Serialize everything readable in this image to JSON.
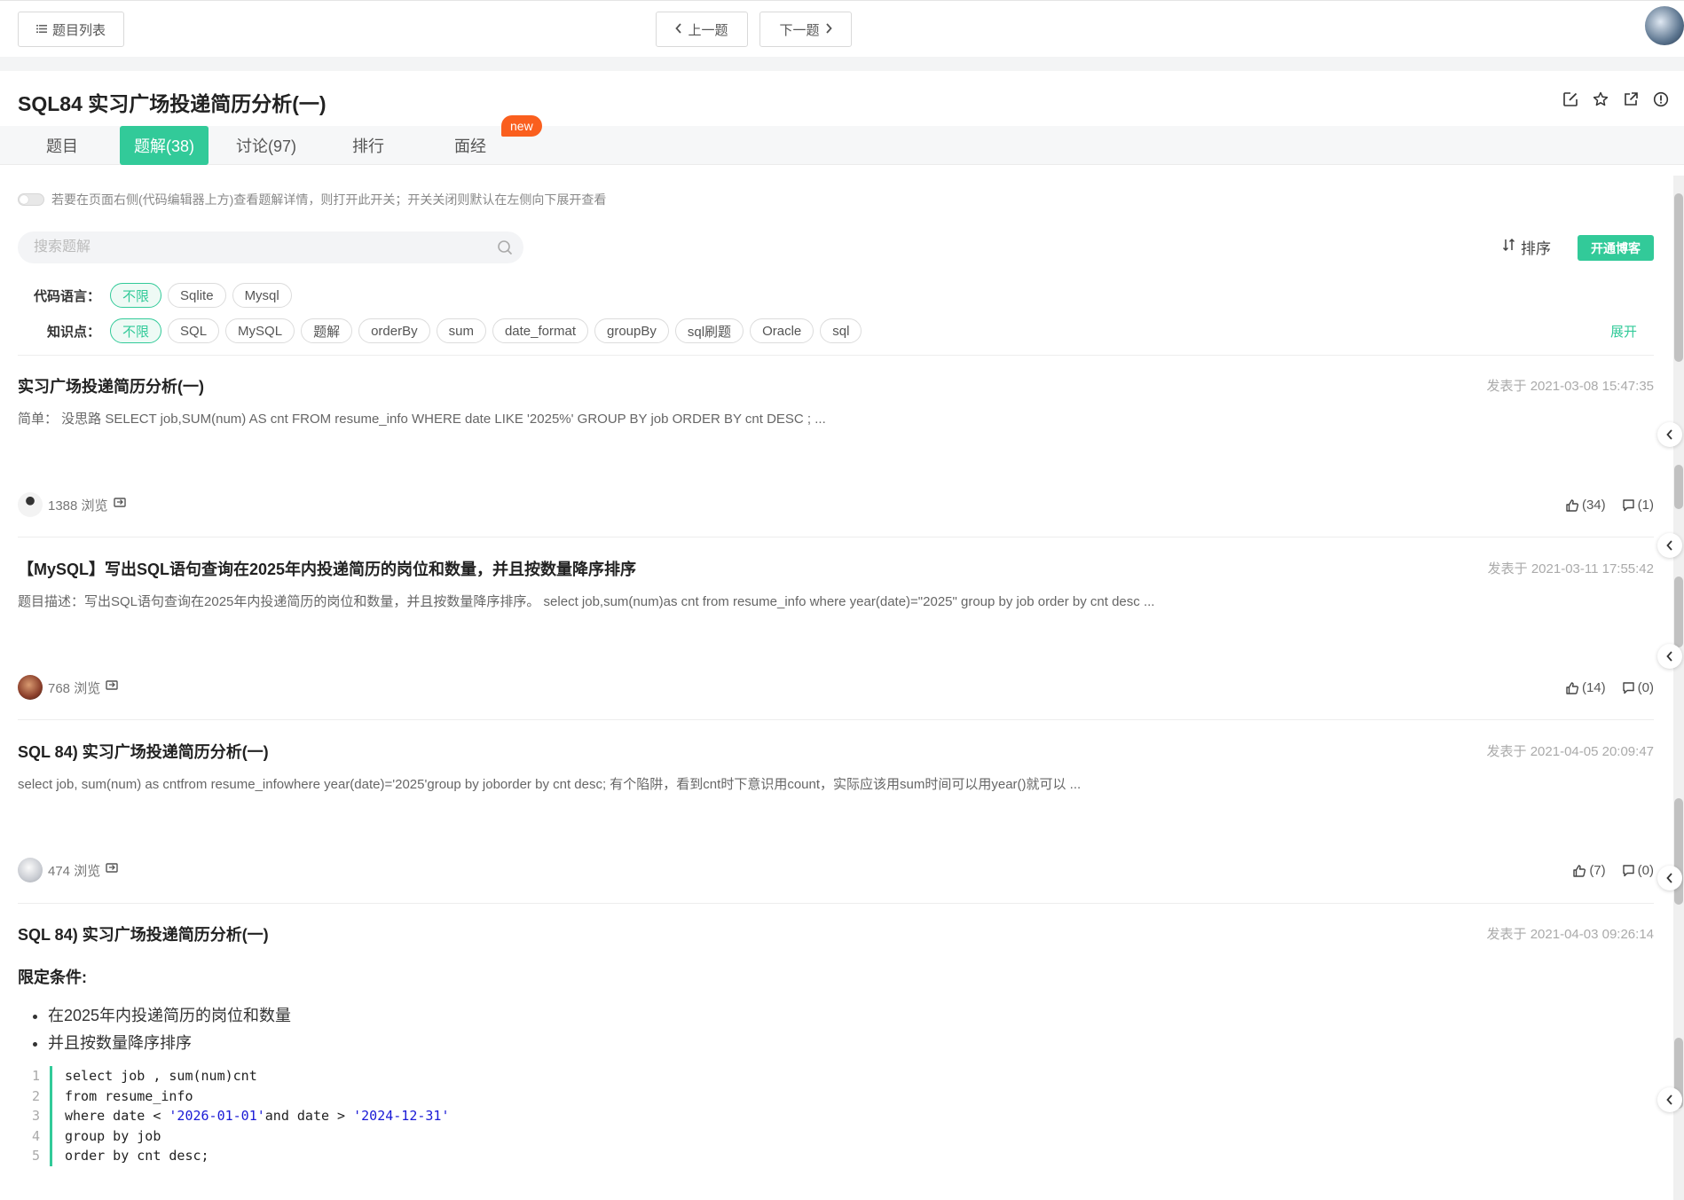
{
  "topbar": {
    "list_label": "题目列表",
    "prev_label": "上一题",
    "next_label": "下一题"
  },
  "problem": {
    "title": "SQL84  实习广场投递简历分析(一)"
  },
  "tabs": [
    {
      "label": "题目"
    },
    {
      "label": "题解(38)"
    },
    {
      "label": "讨论(97)"
    },
    {
      "label": "排行"
    },
    {
      "label": "面经"
    }
  ],
  "badge_new": "new",
  "toggle_hint": "若要在页面右侧(代码编辑器上方)查看题解详情，则打开此开关；开关关闭则默认在左侧向下展开查看",
  "search": {
    "placeholder": "搜索题解"
  },
  "sort_label": "排序",
  "blog_button": "开通博客",
  "filters": {
    "language_label": "代码语言：",
    "languages": [
      "不限",
      "Sqlite",
      "Mysql"
    ],
    "topic_label": "知识点：",
    "topics": [
      "不限",
      "SQL",
      "MySQL",
      "题解",
      "orderBy",
      "sum",
      "date_format",
      "groupBy",
      "sql刷题",
      "Oracle",
      "sql"
    ],
    "expand_label": "展开"
  },
  "articles": [
    {
      "title": "实习广场投递简历分析(一)",
      "date": "发表于 2021-03-08 15:47:35",
      "summary": "简单：  没思路 SELECT job,SUM(num) AS cnt FROM resume_info WHERE date LIKE '2025%' GROUP BY job ORDER BY cnt DESC ; ...",
      "views": "1388 浏览",
      "likes": "(34)",
      "comments": "(1)"
    },
    {
      "title": "【MySQL】写出SQL语句查询在2025年内投递简历的岗位和数量，并且按数量降序排序",
      "date": "发表于 2021-03-11 17:55:42",
      "summary": "题目描述：写出SQL语句查询在2025年内投递简历的岗位和数量，并且按数量降序排序。 select job,sum(num)as cnt from resume_info where year(date)=\"2025\" group by job order by cnt desc ...",
      "views": "768 浏览",
      "likes": "(14)",
      "comments": "(0)"
    },
    {
      "title": "SQL 84) 实习广场投递简历分析(一)",
      "date": "发表于 2021-04-05 20:09:47",
      "summary": "select job, sum(num) as cntfrom resume_infowhere year(date)='2025'group by joborder by cnt desc; 有个陷阱，看到cnt时下意识用count，实际应该用sum时间可以用year()就可以 ...",
      "views": "474 浏览",
      "likes": "(7)",
      "comments": "(0)"
    },
    {
      "title": "SQL 84) 实习广场投递简历分析(一)",
      "date": "发表于 2021-04-03 09:26:14",
      "section_heading": "限定条件:",
      "bullets": [
        "在2025年内投递简历的岗位和数量",
        "并且按数量降序排序"
      ],
      "code": [
        {
          "n": "1",
          "a": "select job , sum(num)cnt",
          "s": "",
          "b": "",
          "s2": ""
        },
        {
          "n": "2",
          "a": "from resume_info",
          "s": "",
          "b": "",
          "s2": ""
        },
        {
          "n": "3",
          "a": "where date < ",
          "s": "'2026-01-01'",
          "b": "and date > ",
          "s2": "'2024-12-31'"
        },
        {
          "n": "4",
          "a": "group by job",
          "s": "",
          "b": "",
          "s2": ""
        },
        {
          "n": "5",
          "a": "order by cnt desc;",
          "s": "",
          "b": "",
          "s2": ""
        }
      ]
    }
  ],
  "colors": {
    "accent": "#32ca99",
    "badge": "#fa5f1e"
  }
}
